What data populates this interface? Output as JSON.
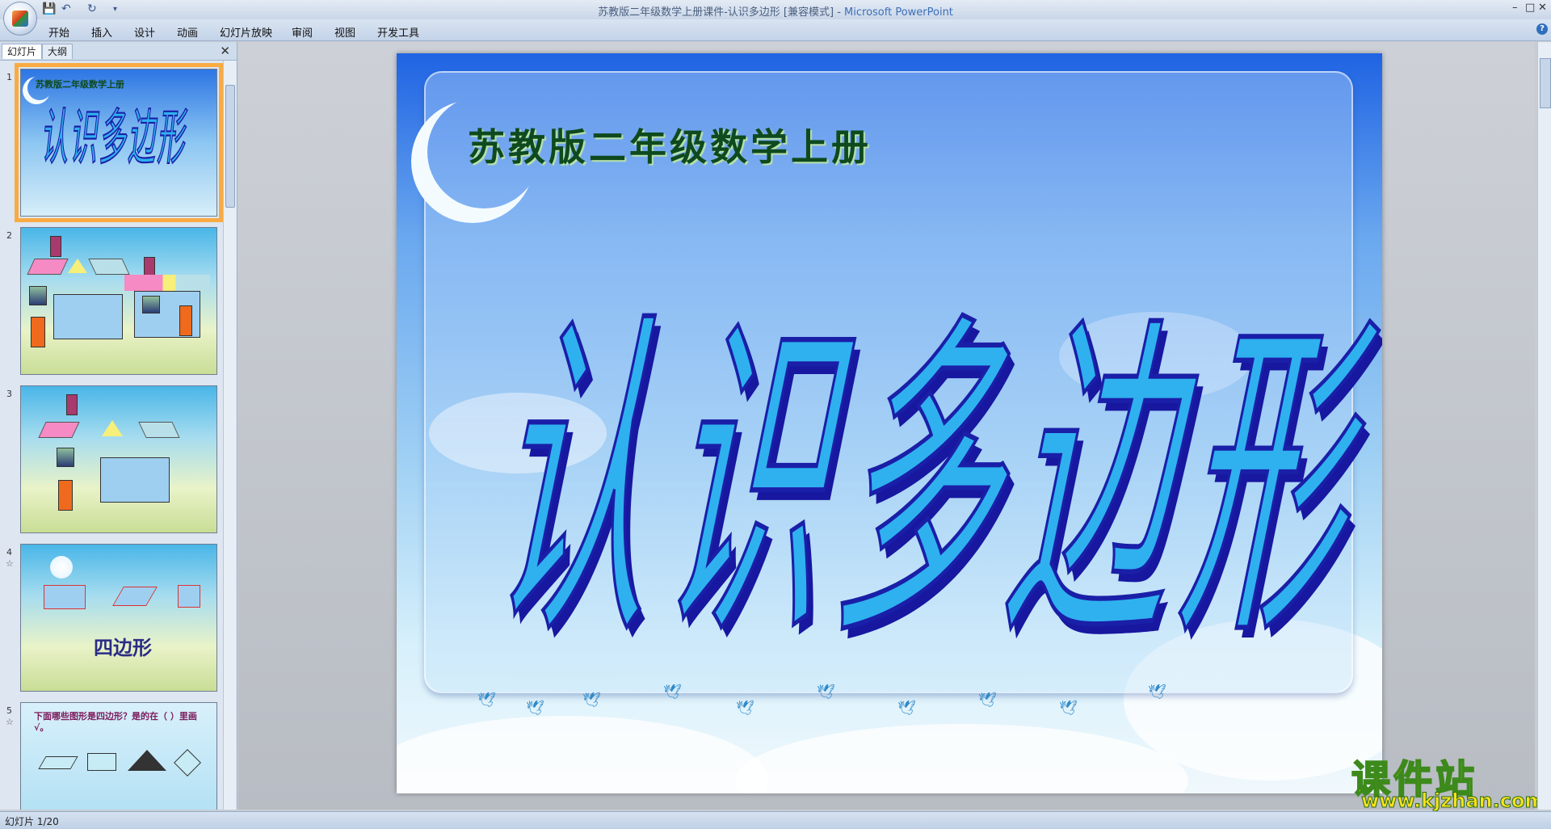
{
  "window": {
    "title_doc": "苏教版二年级数学上册课件-认识多边形 [兼容模式]",
    "title_sep": " - ",
    "title_app": "Microsoft PowerPoint",
    "controls": [
      "–",
      "□",
      "✕"
    ]
  },
  "quick_access": {
    "save_icon": "save-icon",
    "undo_icon": "undo-icon",
    "redo_icon": "redo-icon"
  },
  "ribbon": {
    "tabs": [
      "开始",
      "插入",
      "设计",
      "动画",
      "幻灯片放映",
      "审阅",
      "视图",
      "开发工具"
    ],
    "help_label": "?"
  },
  "pane": {
    "tab_slides": "幻灯片",
    "tab_outline": "大纲",
    "close_label": "✕",
    "slides": [
      {
        "num": "1"
      },
      {
        "num": "2"
      },
      {
        "num": "3"
      },
      {
        "num": "4",
        "star": "☆",
        "label": "四边形"
      },
      {
        "num": "5",
        "star": "☆",
        "question": "下面哪些图形是四边形？是的在（ ）里画√。"
      }
    ],
    "thumb1_subtitle": "苏教版二年级数学上册",
    "thumb1_title": "认识多边形"
  },
  "slide": {
    "subtitle": "苏教版二年级数学上册",
    "title": "认识多边形"
  },
  "watermark": {
    "main": "课件站",
    "url": "www.kjzhan.com"
  },
  "status": {
    "slide_info": "幻灯片 1/20"
  },
  "colors": {
    "accent": "#f9ab43",
    "title_fill": "#2fb1ef",
    "title_outline": "#1a1fa8",
    "subtitle": "#0e4a1e"
  }
}
